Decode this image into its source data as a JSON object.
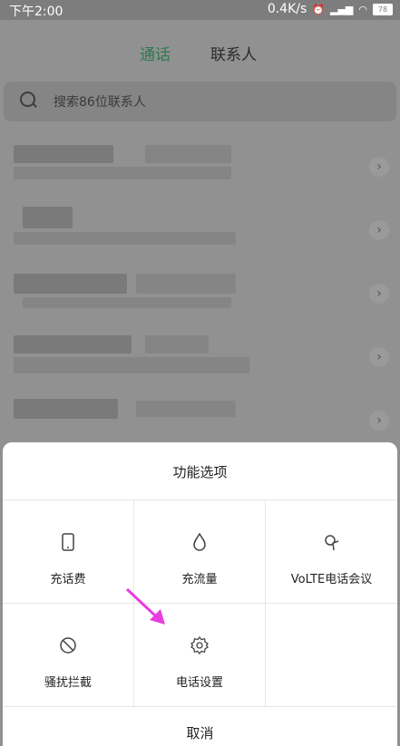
{
  "status": {
    "time": "下午2:00",
    "network_speed": "0.4K/s",
    "battery_level": "78"
  },
  "tabs": [
    {
      "label": "通话",
      "active": true
    },
    {
      "label": "联系人",
      "active": false
    }
  ],
  "search": {
    "placeholder": "搜索86位联系人"
  },
  "sheet": {
    "title": "功能选项",
    "options": [
      {
        "label": "充话费",
        "icon": "phone-icon"
      },
      {
        "label": "充流量",
        "icon": "droplet-icon"
      },
      {
        "label": "VoLTE电话会议",
        "icon": "satellite-dish-icon"
      },
      {
        "label": "骚扰拦截",
        "icon": "block-icon"
      },
      {
        "label": "电话设置",
        "icon": "gear-icon"
      }
    ],
    "cancel_label": "取消"
  },
  "colors": {
    "active_tab": "#2f7a4d",
    "annotation_arrow": "#e83de0"
  }
}
